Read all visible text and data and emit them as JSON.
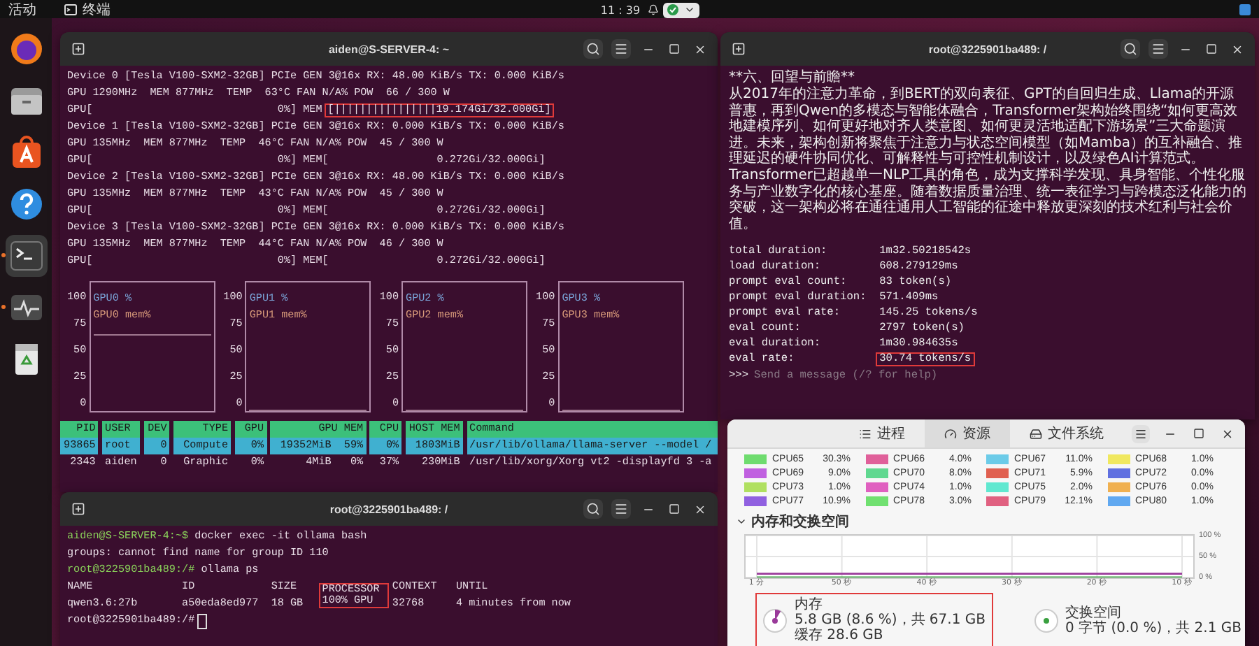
{
  "top_bar": {
    "activities": "活动",
    "app": "终端",
    "clock": "11 : 39"
  },
  "dock": [
    {
      "kind": "browser",
      "running": false,
      "selected": false
    },
    {
      "kind": "files",
      "running": false,
      "selected": false
    },
    {
      "kind": "store",
      "running": false,
      "selected": false
    },
    {
      "kind": "help",
      "running": false,
      "selected": false
    },
    {
      "kind": "terminal",
      "running": true,
      "selected": true
    },
    {
      "kind": "monitor",
      "running": true,
      "selected": false
    },
    {
      "kind": "trash",
      "running": false,
      "selected": false
    }
  ],
  "gpu_terminal": {
    "title": "aiden@S-SERVER-4: ~",
    "lines": [
      {
        "text": "Device 0 [Tesla V100-SXM2-32GB] PCIe GEN 3@16x RX: 48.00 KiB/s TX: 0.000 KiB/s"
      },
      {
        "text": "GPU 1290MHz  MEM 877MHz  TEMP  63°C FAN N/A% POW  66 / 300 W"
      },
      {
        "text": "GPU[                             0%] MEM",
        "marked": "[||||||||||||||||19.174Gi/32.000Gi]"
      },
      {
        "text": "Device 1 [Tesla V100-SXM2-32GB] PCIe GEN 3@16x RX: 0.000 KiB/s TX: 0.000 KiB/s"
      },
      {
        "text": "GPU 135MHz  MEM 877MHz  TEMP  46°C FAN N/A% POW  45 / 300 W"
      },
      {
        "text": "GPU[                             0%] MEM[                 0.272Gi/32.000Gi]"
      },
      {
        "text": "Device 2 [Tesla V100-SXM2-32GB] PCIe GEN 3@16x RX: 48.00 KiB/s TX: 0.000 KiB/s"
      },
      {
        "text": "GPU 135MHz  MEM 877MHz  TEMP  43°C FAN N/A% POW  45 / 300 W"
      },
      {
        "text": "GPU[                             0%] MEM[                 0.272Gi/32.000Gi]"
      },
      {
        "text": "Device 3 [Tesla V100-SXM2-32GB] PCIe GEN 3@16x RX: 0.000 KiB/s TX: 0.000 KiB/s"
      },
      {
        "text": "GPU 135MHz  MEM 877MHz  TEMP  44°C FAN N/A% POW  46 / 300 W"
      },
      {
        "text": "GPU[                             0%] MEM[                 0.272Gi/32.000Gi]"
      }
    ],
    "graphs": [
      {
        "gpu_label": "GPU0 %",
        "mem_label": "GPU0 mem%",
        "level": 0.6,
        "yticks": [
          "100",
          "75",
          "50",
          "25",
          "0"
        ]
      },
      {
        "gpu_label": "GPU1 %",
        "mem_label": "GPU1 mem%",
        "level": 0,
        "yticks": [
          "100",
          "75",
          "50",
          "25",
          "0"
        ]
      },
      {
        "gpu_label": "GPU2 %",
        "mem_label": "GPU2 mem%",
        "level": 0,
        "yticks": [
          "100",
          "75",
          "50",
          "25",
          "0"
        ]
      },
      {
        "gpu_label": "GPU3 %",
        "mem_label": "GPU3 mem%",
        "level": 0,
        "yticks": [
          "100",
          "75",
          "50",
          "25",
          "0"
        ]
      }
    ],
    "processes": {
      "columns": [
        "PID",
        "USER",
        "DEV",
        "TYPE",
        "GPU",
        "GPU MEM",
        "CPU",
        "HOST MEM",
        "Command"
      ],
      "rows": [
        {
          "selected": true,
          "cells": [
            "93865",
            "root",
            "0",
            "Compute",
            "0%",
            "19352MiB  59%",
            "0%",
            "1803MiB",
            "/usr/lib/ollama/llama-server --model /"
          ]
        },
        {
          "selected": false,
          "cells": [
            "2343",
            "aiden",
            "0",
            "Graphic",
            "0%",
            "4MiB   0%",
            "37%",
            "230MiB",
            "/usr/lib/xorg/Xorg vt2 -displayfd 3 -a"
          ]
        }
      ]
    }
  },
  "shell_terminal": {
    "title": "root@3225901ba489: /",
    "lines": [
      {
        "prompt": "aiden@S-SERVER-4:~$",
        "command": "docker exec -it ollama bash"
      },
      {
        "text": "groups: cannot find name for group ID 110"
      },
      {
        "prompt": "root@3225901ba489:/#",
        "command": "ollama ps"
      }
    ],
    "table": {
      "columns": [
        {
          "label": "NAME",
          "highlighted": false
        },
        {
          "label": "ID",
          "highlighted": false
        },
        {
          "label": "SIZE",
          "highlighted": false
        },
        {
          "label": "PROCESSOR",
          "highlighted": true
        },
        {
          "label": "CONTEXT",
          "highlighted": false
        },
        {
          "label": "UNTIL",
          "highlighted": false
        }
      ],
      "rows": [
        [
          "qwen3.6:27b",
          "a50eda8ed977",
          "18 GB",
          "100% GPU",
          "32768",
          "4 minutes from now"
        ]
      ]
    },
    "final_prompt": "root@3225901ba489:/#"
  },
  "chat_terminal": {
    "title": "root@3225901ba489: /",
    "heading": "**六、回望与前瞻**",
    "paragraph": "从2017年的注意力革命，到BERT的双向表征、GPT的自回归生成、Llama的开源普惠，再到Qwen的多模态与智能体融合，Transformer架构始终围绕“如何更高效地建模序列、如何更好地对齐人类意图、如何更灵活地适配下游场景”三大命题演进。未来，架构创新将聚焦于注意力与状态空间模型（如Mamba）的互补融合、推理延迟的硬件协同优化、可解释性与可控性机制设计，以及绿色AI计算范式。Transformer已超越单一NLP工具的角色，成为支撑科学发现、具身智能、个性化服务与产业数字化的核心基座。随着数据质量治理、统一表征学习与跨模态泛化能力的突破，这一架构必将在通往通用人工智能的征途中释放更深刻的技术红利与社会价值。",
    "stats": [
      {
        "label": "total duration:",
        "value": "1m32.50218542s",
        "highlighted": false
      },
      {
        "label": "load duration:",
        "value": "608.279129ms",
        "highlighted": false
      },
      {
        "label": "prompt eval count:",
        "value": "83 token(s)",
        "highlighted": false
      },
      {
        "label": "prompt eval duration:",
        "value": "571.409ms",
        "highlighted": false
      },
      {
        "label": "prompt eval rate:",
        "value": "145.25 tokens/s",
        "highlighted": false
      },
      {
        "label": "eval count:",
        "value": "2797 token(s)",
        "highlighted": false
      },
      {
        "label": "eval duration:",
        "value": "1m30.984635s",
        "highlighted": false
      },
      {
        "label": "eval rate:",
        "value": "30.74 tokens/s",
        "highlighted": true
      }
    ],
    "prompt": ">>>",
    "placeholder": "Send a message (/? for help)"
  },
  "system_monitor": {
    "tabs": [
      {
        "label": "进程",
        "kind": "list",
        "selected": false
      },
      {
        "label": "资源",
        "kind": "gauge",
        "selected": true
      },
      {
        "label": "文件系统",
        "kind": "disk",
        "selected": false
      }
    ],
    "cpus": [
      {
        "name": "CPU65",
        "value": "30.3%",
        "color": "#6fdc6f"
      },
      {
        "name": "CPU66",
        "value": "4.0%",
        "color": "#e0609a"
      },
      {
        "name": "CPU67",
        "value": "11.0%",
        "color": "#6ccbe8"
      },
      {
        "name": "CPU68",
        "value": "1.0%",
        "color": "#f0e860"
      },
      {
        "name": "CPU69",
        "value": "9.0%",
        "color": "#c060e0"
      },
      {
        "name": "CPU70",
        "value": "8.0%",
        "color": "#60d890"
      },
      {
        "name": "CPU71",
        "value": "5.9%",
        "color": "#e06050"
      },
      {
        "name": "CPU72",
        "value": "0.0%",
        "color": "#6070e0"
      },
      {
        "name": "CPU73",
        "value": "1.0%",
        "color": "#b0e060"
      },
      {
        "name": "CPU74",
        "value": "1.0%",
        "color": "#e060c0"
      },
      {
        "name": "CPU75",
        "value": "2.0%",
        "color": "#60e8d0"
      },
      {
        "name": "CPU76",
        "value": "0.0%",
        "color": "#f0b050"
      },
      {
        "name": "CPU77",
        "value": "10.9%",
        "color": "#9060e0"
      },
      {
        "name": "CPU78",
        "value": "3.0%",
        "color": "#70e070"
      },
      {
        "name": "CPU79",
        "value": "12.1%",
        "color": "#e06080"
      },
      {
        "name": "CPU80",
        "value": "1.0%",
        "color": "#60a8f0"
      }
    ],
    "section": {
      "title": "内存和交换空间",
      "expanded": true
    },
    "chart_data": {
      "type": "line",
      "x": [
        "1 分",
        "50 秒",
        "40 秒",
        "30 秒",
        "20 秒",
        "10 秒"
      ],
      "series": [
        {
          "name": "内存",
          "color": "#9a3a9a",
          "values": [
            9,
            9,
            9,
            9,
            9,
            9
          ]
        },
        {
          "name": "交换空间",
          "color": "#3aa040",
          "values": [
            0,
            0,
            0,
            0,
            0,
            0
          ]
        }
      ],
      "ylim": [
        0,
        100
      ],
      "grid": true,
      "yticks": [
        {
          "value": 100,
          "label": "100 %"
        },
        {
          "value": 50,
          "label": "50 %"
        },
        {
          "value": 0,
          "label": "0 %"
        }
      ]
    },
    "memory": [
      {
        "kind": "memory",
        "usage": "5.8 GB (8.6 %)，共 67.1 GB",
        "cache": "缓存 28.6 GB",
        "level": 0.086,
        "highlighted": true
      },
      {
        "kind": "swap",
        "usage": "0 字节 (0.0 %)，共 2.1 GB",
        "level": 0,
        "highlighted": false
      }
    ]
  }
}
